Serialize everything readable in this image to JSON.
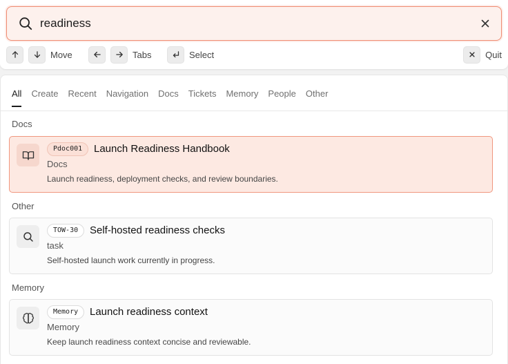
{
  "search": {
    "value": "readiness",
    "placeholder": ""
  },
  "hints": {
    "move": "Move",
    "tabs": "Tabs",
    "select": "Select",
    "quit": "Quit"
  },
  "tabs": [
    "All",
    "Create",
    "Recent",
    "Navigation",
    "Docs",
    "Tickets",
    "Memory",
    "People",
    "Other"
  ],
  "sections": {
    "docs": {
      "title": "Docs",
      "item": {
        "badge": "Pdoc001",
        "title": "Launch Readiness Handbook",
        "category": "Docs",
        "description": "Launch readiness, deployment checks, and review boundaries.",
        "icon": "book-open-icon"
      }
    },
    "other": {
      "title": "Other",
      "item": {
        "badge": "TOW-30",
        "title": "Self-hosted readiness checks",
        "category": "task",
        "description": "Self-hosted launch work currently in progress.",
        "icon": "search-icon"
      }
    },
    "memory": {
      "title": "Memory",
      "item": {
        "badge": "Memory",
        "title": "Launch readiness context",
        "category": "Memory",
        "description": "Keep launch readiness context concise and reviewable.",
        "icon": "brain-icon"
      }
    }
  },
  "colors": {
    "accent": "#ef8a70",
    "selected_bg": "#fde9e2"
  }
}
